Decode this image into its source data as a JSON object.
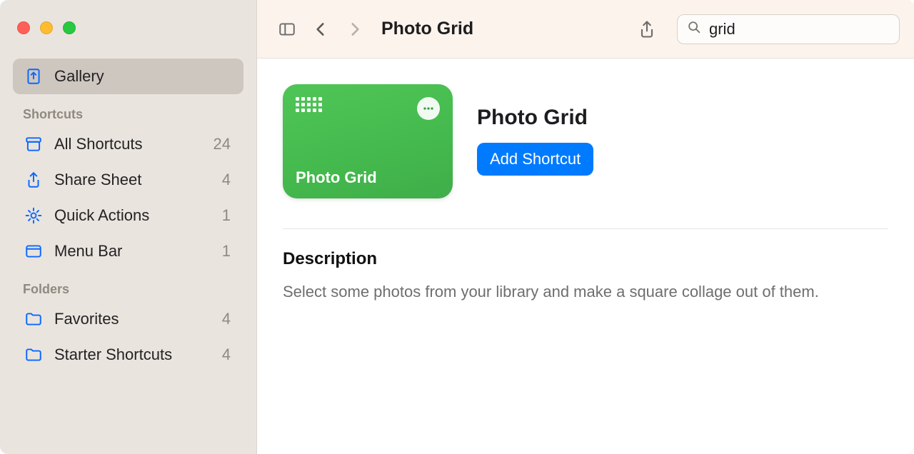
{
  "sidebar": {
    "gallery": {
      "label": "Gallery"
    },
    "section_shortcuts_title": "Shortcuts",
    "section_folders_title": "Folders",
    "items": {
      "all": {
        "label": "All Shortcuts",
        "count": "24"
      },
      "share": {
        "label": "Share Sheet",
        "count": "4"
      },
      "quick": {
        "label": "Quick Actions",
        "count": "1"
      },
      "menu": {
        "label": "Menu Bar",
        "count": "1"
      }
    },
    "folders": {
      "favorites": {
        "label": "Favorites",
        "count": "4"
      },
      "starter": {
        "label": "Starter Shortcuts",
        "count": "4"
      }
    }
  },
  "toolbar": {
    "title": "Photo Grid",
    "search_value": "grid"
  },
  "shortcut": {
    "tile_title": "Photo Grid",
    "title": "Photo Grid",
    "add_label": "Add Shortcut",
    "description_heading": "Description",
    "description_body": "Select some photos from your library and make a square collage out of them."
  }
}
